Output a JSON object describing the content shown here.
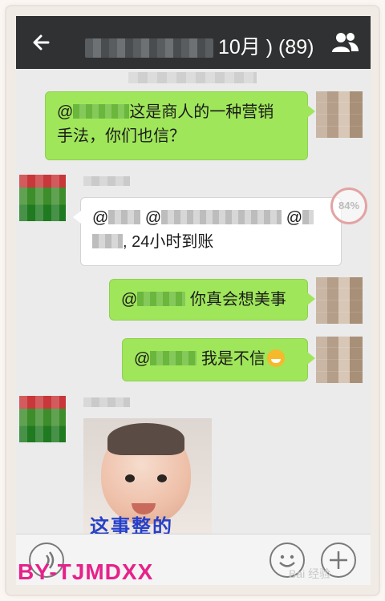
{
  "header": {
    "title_suffix": "10月 ) (89)",
    "back_icon": "arrow-left-icon",
    "members_icon": "people-icon"
  },
  "messages": [
    {
      "side": "right",
      "line1": "这是商人的一种营销",
      "line2": "手法，你们也信？",
      "prefix": "@"
    },
    {
      "side": "left",
      "line1_a": "@",
      "line1_b": "@",
      "line1_c": "@",
      "line2": "24小时到账"
    },
    {
      "side": "right",
      "prefix": "@",
      "text": "你真会想美事"
    },
    {
      "side": "right",
      "prefix": "@",
      "text": "我是不信"
    },
    {
      "side": "left",
      "image_caption": "这事整的"
    }
  ],
  "progress": {
    "label": "84%",
    "value": 0.84
  },
  "bottom": {
    "voice_icon": "voice-icon",
    "emoji_icon": "smiley-icon",
    "plus_icon": "plus-icon"
  },
  "watermark": "BY-TJMDXX",
  "baidu": "Bai 经验",
  "colors": {
    "green_bubble": "#9fe65a",
    "topbar": "#2f3133",
    "watermark": "#e6228a"
  }
}
